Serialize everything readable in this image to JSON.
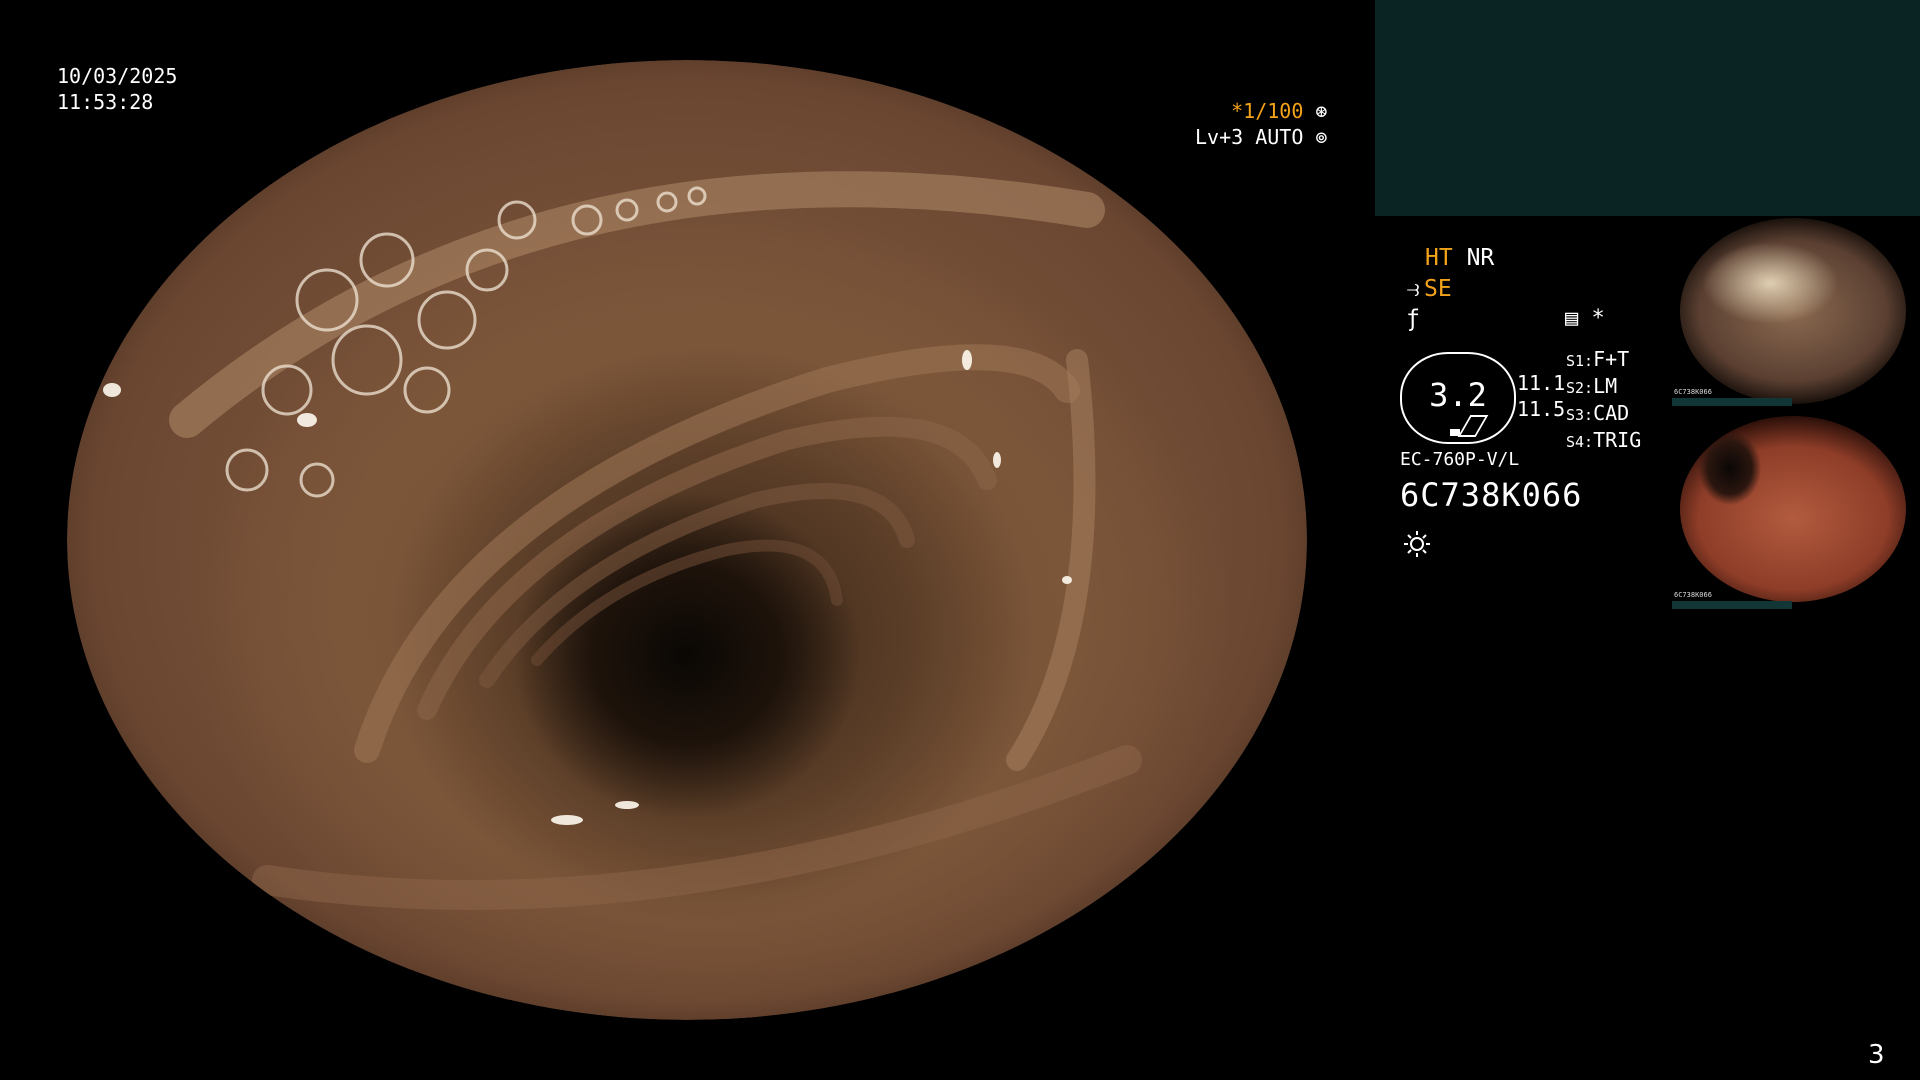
{
  "overlay": {
    "date": "10/03/2025",
    "time": "11:53:28",
    "shutter": "*1/100",
    "level": "Lv+3 AUTO"
  },
  "panel": {
    "ht": "HT",
    "nr": "NR",
    "se": "SE",
    "settings_star": "*",
    "meter_value": "3.2",
    "meter_left": "11.1",
    "meter_right": "11.5",
    "specs": [
      {
        "key": "S1:",
        "value": "F+T"
      },
      {
        "key": "S2:",
        "value": "LM"
      },
      {
        "key": "S3:",
        "value": "CAD"
      },
      {
        "key": "S4:",
        "value": "TRIG"
      }
    ],
    "scope_model": "EC-760P-V/L",
    "scope_serial": "6C738K066",
    "thumb_1_label": "6C738K066",
    "thumb_2_label": "6C738K066"
  },
  "page_number": "3",
  "colors": {
    "accent": "#f4a21a",
    "panel_teal": "#0a2424",
    "background": "#000000"
  }
}
